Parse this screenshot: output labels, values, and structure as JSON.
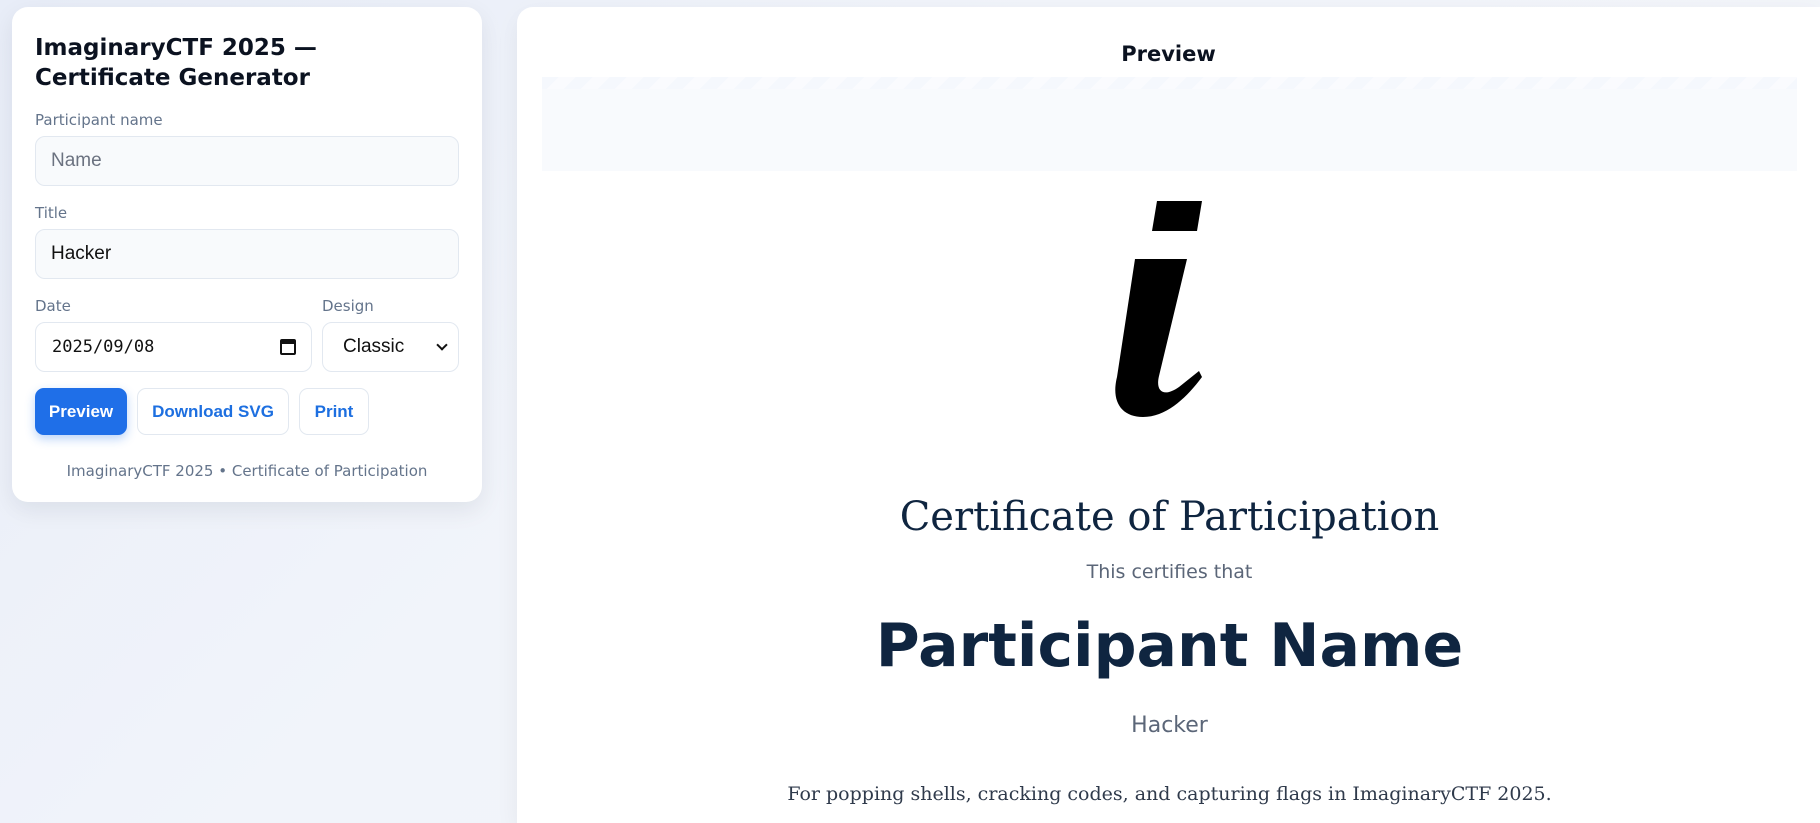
{
  "app": {
    "title": "ImaginaryCTF 2025 — Certificate Generator"
  },
  "form": {
    "participant_name_label": "Participant name",
    "participant_name_placeholder": "Name",
    "participant_name_value": "",
    "title_label": "Title",
    "title_value": "Hacker",
    "date_label": "Date",
    "date_value": "2025/09/08",
    "design_label": "Design",
    "design_value": "Classic"
  },
  "buttons": {
    "preview": "Preview",
    "download_svg": "Download SVG",
    "print": "Print"
  },
  "panel_footer": "ImaginaryCTF 2025 • Certificate of Participation",
  "preview": {
    "heading": "Preview",
    "certificate": {
      "logo_letter": "i",
      "title": "Certificate of Participation",
      "subtitle": "This certifies that",
      "name": "Participant Name",
      "role": "Hacker",
      "description": "For popping shells, cracking codes, and capturing flags in ImaginaryCTF 2025."
    }
  },
  "colors": {
    "accent": "#1f6fe8",
    "heading_navy": "#0f2540",
    "muted": "#64748b"
  },
  "icons": [
    "calendar-icon",
    "chevron-down-icon"
  ]
}
